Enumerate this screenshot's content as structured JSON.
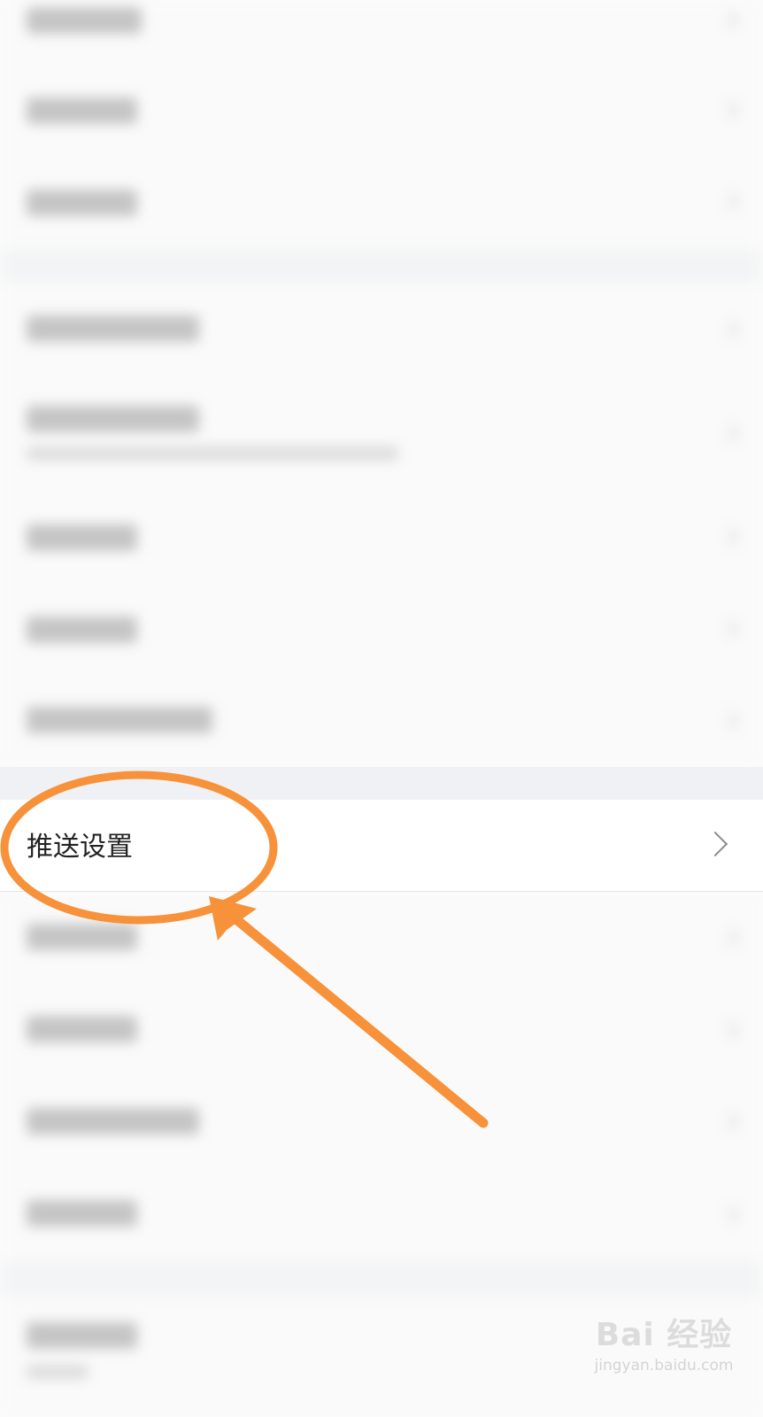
{
  "settings": {
    "push_settings_label": "推送设置"
  },
  "watermark": {
    "brand": "Bai  经验",
    "site": "jingyan.baidu.com"
  },
  "colors": {
    "annotation": "#f7913a",
    "section_gap": "#eff1f4",
    "label_text": "#222222"
  },
  "icons": {
    "chevron": "chevron-right-icon",
    "watermark_logo": "baidu-paw-icon"
  }
}
